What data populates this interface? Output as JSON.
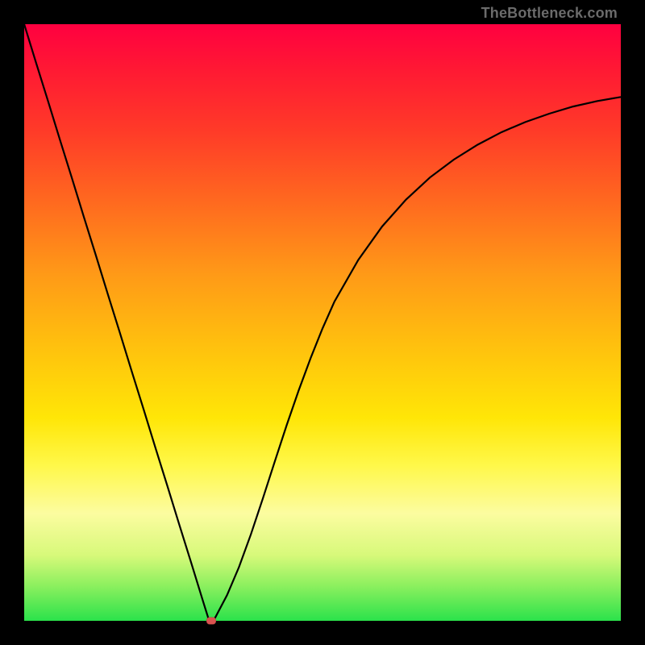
{
  "watermark": "TheBottleneck.com",
  "colors": {
    "frame": "#000000",
    "curve": "#000000",
    "marker": "#d9534f",
    "gradient_top": "#ff0040",
    "gradient_bottom": "#2be24b"
  },
  "chart_data": {
    "type": "line",
    "title": "",
    "xlabel": "",
    "ylabel": "",
    "xlim": [
      0,
      100
    ],
    "ylim": [
      0,
      100
    ],
    "x": [
      0,
      2,
      4,
      6,
      8,
      10,
      12,
      14,
      16,
      18,
      20,
      22,
      24,
      26,
      28,
      30,
      31,
      31.5,
      32,
      34,
      36,
      38,
      40,
      42,
      44,
      46,
      48,
      50,
      52,
      56,
      60,
      64,
      68,
      72,
      76,
      80,
      84,
      88,
      92,
      96,
      100
    ],
    "y": [
      100,
      93.5,
      87.1,
      80.6,
      74.2,
      67.7,
      61.3,
      54.8,
      48.4,
      41.9,
      35.5,
      29.0,
      22.6,
      16.1,
      9.7,
      3.2,
      0,
      0,
      0.5,
      4.3,
      9.0,
      14.5,
      20.5,
      26.7,
      32.8,
      38.6,
      44.0,
      49.0,
      53.5,
      60.5,
      66.1,
      70.6,
      74.3,
      77.3,
      79.8,
      81.9,
      83.6,
      85.0,
      86.2,
      87.1,
      87.8
    ],
    "marker": {
      "x": 31.3,
      "y": 0
    },
    "grid": false,
    "legend": false
  }
}
